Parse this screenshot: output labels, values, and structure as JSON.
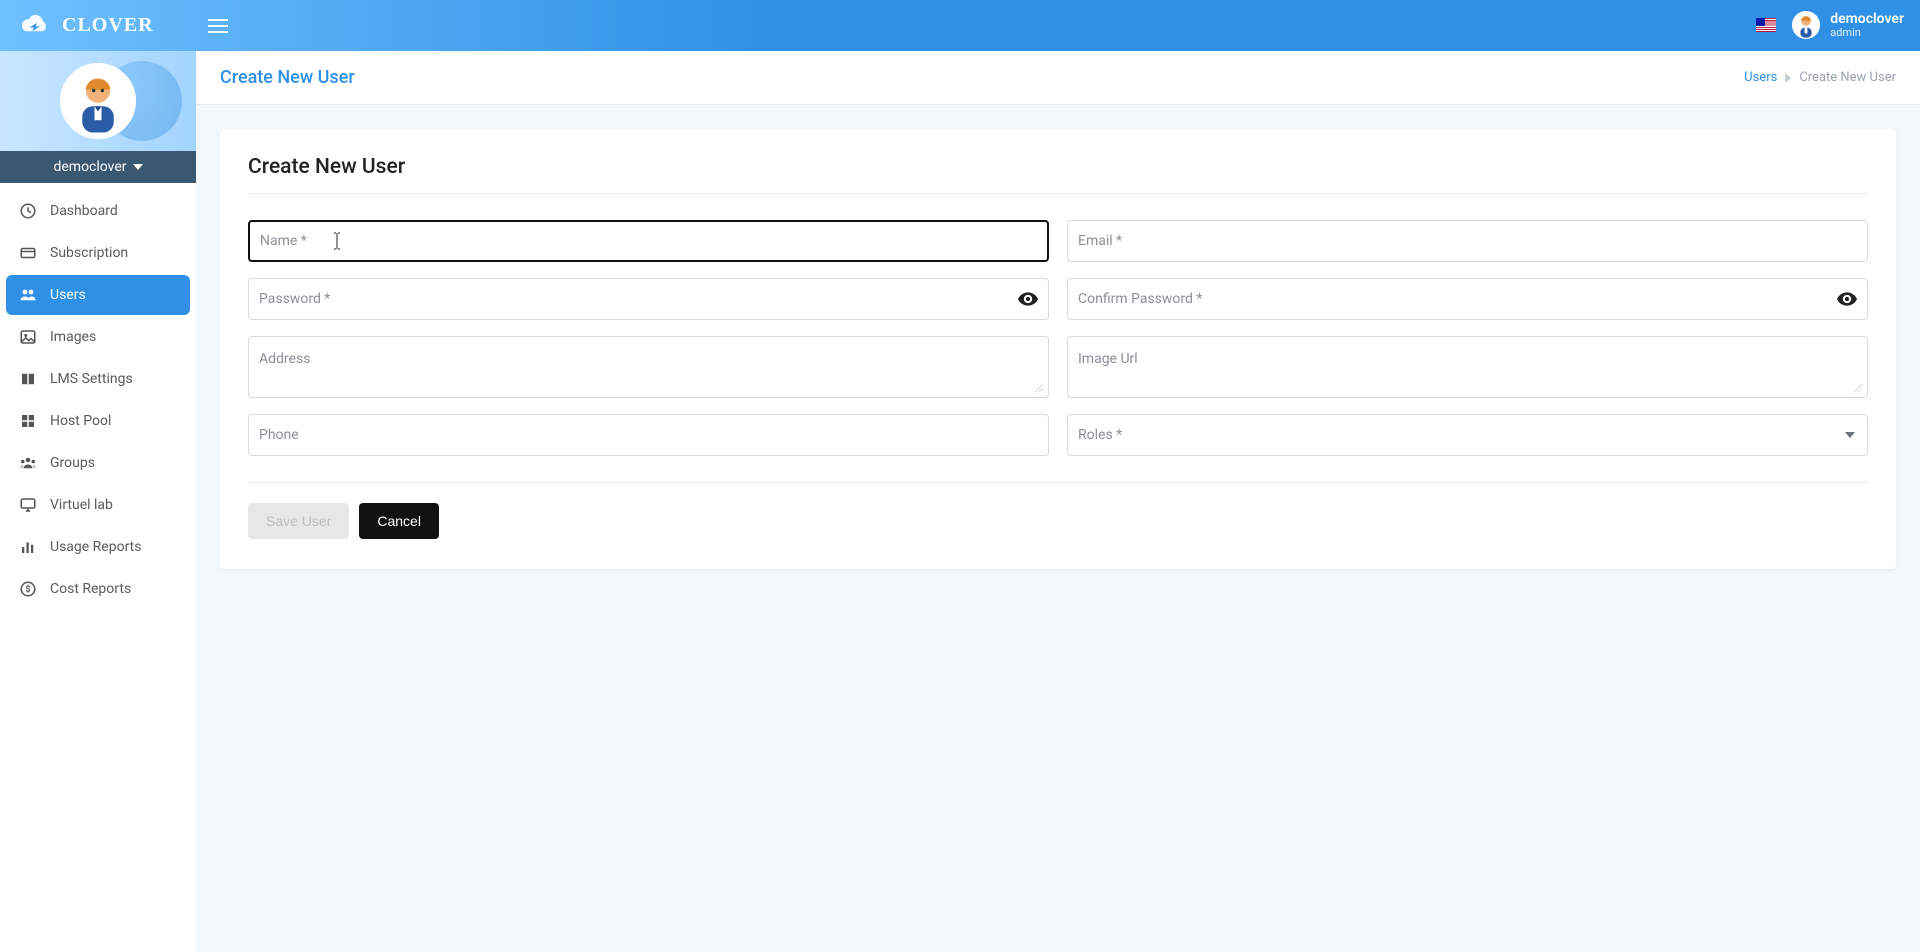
{
  "header": {
    "app_name": "CLOVER",
    "user_name": "democlover",
    "user_role": "admin"
  },
  "sidebar": {
    "user_label": "democlover",
    "items": [
      {
        "label": "Dashboard",
        "icon": "dashboard"
      },
      {
        "label": "Subscription",
        "icon": "subscription"
      },
      {
        "label": "Users",
        "icon": "users",
        "active": true
      },
      {
        "label": "Images",
        "icon": "images"
      },
      {
        "label": "LMS Settings",
        "icon": "lms"
      },
      {
        "label": "Host Pool",
        "icon": "hostpool"
      },
      {
        "label": "Groups",
        "icon": "groups"
      },
      {
        "label": "Virtuel lab",
        "icon": "monitor"
      },
      {
        "label": "Usage Reports",
        "icon": "bar"
      },
      {
        "label": "Cost Reports",
        "icon": "dollar"
      }
    ]
  },
  "page": {
    "title": "Create New User",
    "breadcrumb_root": "Users",
    "breadcrumb_leaf": "Create New User"
  },
  "form": {
    "heading": "Create New User",
    "name_label": "Name *",
    "email_label": "Email *",
    "password_label": "Password *",
    "confirm_label": "Confirm Password *",
    "address_label": "Address",
    "imageurl_label": "Image Url",
    "phone_label": "Phone",
    "roles_label": "Roles *",
    "save_label": "Save User",
    "cancel_label": "Cancel"
  }
}
